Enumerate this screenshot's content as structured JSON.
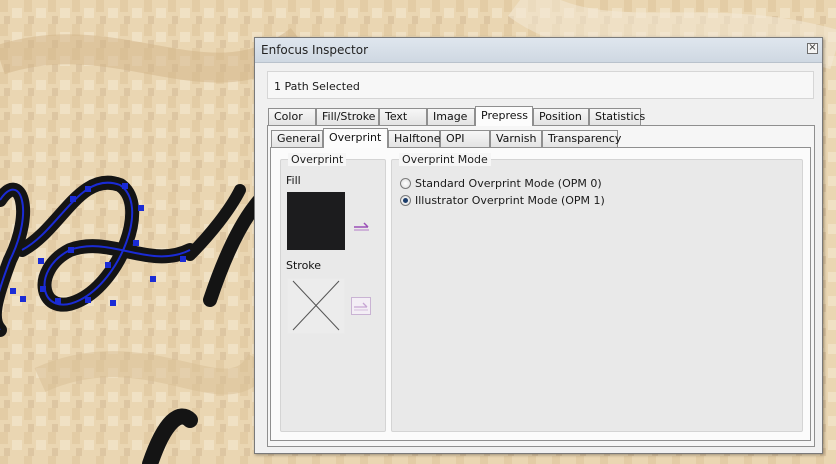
{
  "window": {
    "title": "Enfocus Inspector",
    "close_glyph": "×"
  },
  "selection": {
    "status": "1 Path Selected"
  },
  "main_tabs": [
    {
      "label": "Color",
      "active": false
    },
    {
      "label": "Fill/Stroke",
      "active": false
    },
    {
      "label": "Text",
      "active": false
    },
    {
      "label": "Image",
      "active": false
    },
    {
      "label": "Prepress",
      "active": true
    },
    {
      "label": "Position",
      "active": false
    },
    {
      "label": "Statistics",
      "active": false
    }
  ],
  "sub_tabs": [
    {
      "label": "General",
      "active": false
    },
    {
      "label": "Overprint",
      "active": true
    },
    {
      "label": "Halftone",
      "active": false
    },
    {
      "label": "OPI",
      "active": false
    },
    {
      "label": "Varnish",
      "active": false
    },
    {
      "label": "Transparency",
      "active": false
    }
  ],
  "overprint": {
    "group_title": "Overprint",
    "fill_label": "Fill",
    "stroke_label": "Stroke",
    "fill_color": "#1c1c1e",
    "fill_toggle_icon": "overprint-toggle-icon",
    "stroke_toggle_icon": "overprint-toggle-icon"
  },
  "overprint_mode": {
    "group_title": "Overprint Mode",
    "options": [
      {
        "label": "Standard Overprint Mode (OPM 0)",
        "selected": false
      },
      {
        "label": "Illustrator Overprint Mode (OPM 1)",
        "selected": true
      }
    ]
  },
  "colors": {
    "canvas_bg": "#e8d3ad",
    "selection_path": "#1a2bd6",
    "script_text": "#141414"
  }
}
